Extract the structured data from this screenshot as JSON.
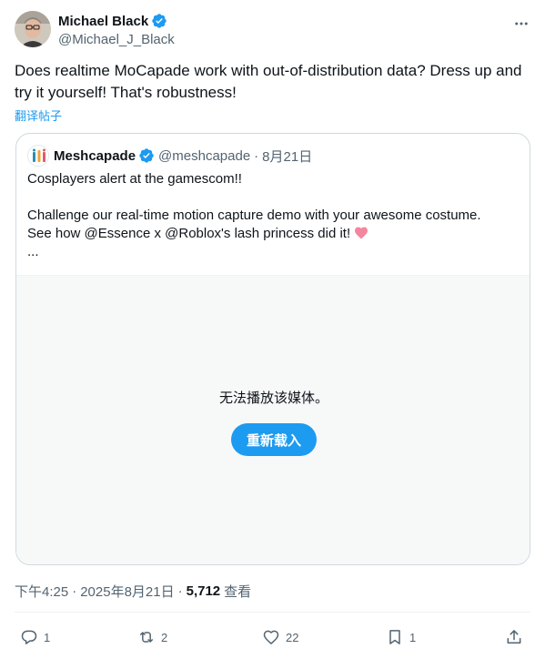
{
  "tweet": {
    "author_name": "Michael Black",
    "author_handle": "@Michael_J_Black",
    "text": "Does realtime MoCapade work with out-of-distribution data?  Dress up and try it yourself!  That's robustness!",
    "translate_label": "翻译帖子",
    "time": "下午4:25",
    "date": "2025年8月21日",
    "views_count": "5,712",
    "views_label": "查看"
  },
  "quote": {
    "author_name": "Meshcapade",
    "author_handle": "@meshcapade",
    "date": "8月21日",
    "line1": "Cosplayers alert at the gamescom!!",
    "line2": "Challenge our real-time motion capture demo with your awesome costume.",
    "line3": "See how @Essence x @Roblox's lash princess did it!",
    "ellipsis": "...",
    "media_message": "无法播放该媒体。",
    "reload_label": "重新载入"
  },
  "actions": {
    "replies": "1",
    "reposts": "2",
    "likes": "22",
    "bookmarks": "1"
  },
  "colors": {
    "accent": "#1d9bf0",
    "secondary_text": "#536471",
    "border": "#cfd9de"
  },
  "icons": [
    "verified-badge-icon",
    "more-icon",
    "heart-emoji-icon",
    "reply-icon",
    "repost-icon",
    "like-icon",
    "bookmark-icon",
    "share-icon"
  ]
}
